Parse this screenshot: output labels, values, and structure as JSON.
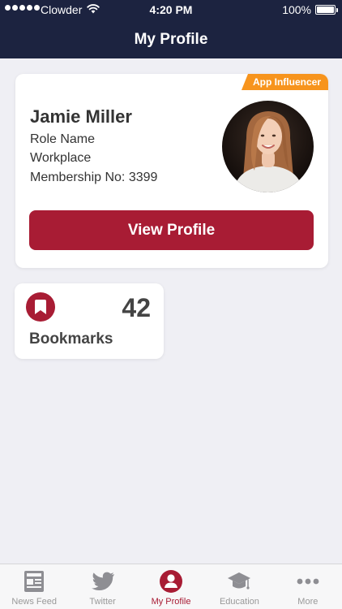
{
  "status_bar": {
    "carrier": "Clowder",
    "time": "4:20 PM",
    "battery": "100%"
  },
  "nav": {
    "title": "My Profile"
  },
  "profile": {
    "badge": "App Influencer",
    "name": "Jamie Miller",
    "role": "Role Name",
    "workplace": "Workplace",
    "membership": "Membership No: 3399",
    "view_profile_label": "View Profile"
  },
  "bookmarks": {
    "count": "42",
    "label": "Bookmarks"
  },
  "tab_bar": {
    "items": [
      {
        "label": "News Feed",
        "icon": "newspaper-icon"
      },
      {
        "label": "Twitter",
        "icon": "twitter-bird-icon"
      },
      {
        "label": "My Profile",
        "icon": "user-circle-icon"
      },
      {
        "label": "Education",
        "icon": "graduation-cap-icon"
      },
      {
        "label": "More",
        "icon": "more-dots-icon"
      }
    ]
  },
  "colors": {
    "header_bg": "#1c2340",
    "accent": "#a81c34",
    "badge": "#f7941d",
    "inactive_tab": "#999999"
  }
}
